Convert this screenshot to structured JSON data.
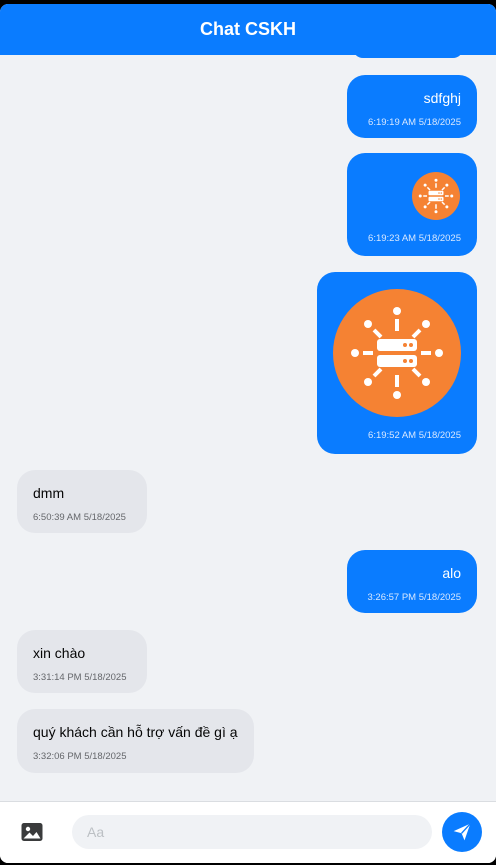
{
  "header": {
    "title": "Chat CSKH"
  },
  "messages": [
    {
      "kind": "text",
      "sender": "user",
      "text": "sdfghj",
      "time": "6:19:19 AM 5/18/2025"
    },
    {
      "kind": "image",
      "sender": "user",
      "icon": "server-network-icon",
      "time": "6:19:23 AM 5/18/2025"
    },
    {
      "kind": "image",
      "sender": "user",
      "icon": "server-network-icon",
      "time": "6:19:52 AM 5/18/2025"
    },
    {
      "kind": "text",
      "sender": "agent",
      "text": "dmm",
      "time": "6:50:39 AM 5/18/2025"
    },
    {
      "kind": "text",
      "sender": "user",
      "text": "alo",
      "time": "3:26:57 PM 5/18/2025"
    },
    {
      "kind": "text",
      "sender": "agent",
      "text": "xin chào",
      "time": "3:31:14 PM 5/18/2025"
    },
    {
      "kind": "text",
      "sender": "agent",
      "text": "quý khách cần hỗ trợ vấn đề gì ạ",
      "time": "3:32:06 PM 5/18/2025"
    }
  ],
  "composer": {
    "placeholder": "Aa",
    "value": "",
    "attach_icon": "image-icon",
    "send_icon": "send-icon"
  },
  "colors": {
    "accent": "#0a7cff",
    "incoming_bubble": "#e4e6eb",
    "background": "#f0f2f5",
    "image_circle": "#f58233"
  }
}
